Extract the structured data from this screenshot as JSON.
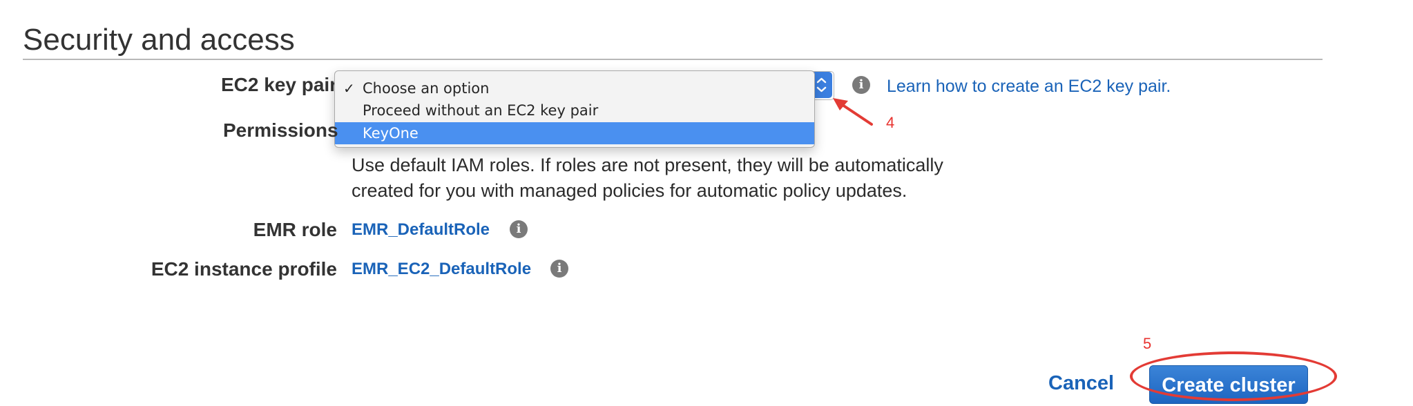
{
  "section": {
    "title": "Security and access"
  },
  "ec2_key_pair": {
    "label": "EC2 key pair",
    "options": [
      {
        "label": "Choose an option",
        "checked": true,
        "highlighted": false
      },
      {
        "label": "Proceed without an EC2 key pair",
        "checked": false,
        "highlighted": false
      },
      {
        "label": "KeyOne",
        "checked": false,
        "highlighted": true
      }
    ],
    "check_mark": "✓",
    "info_icon": "info-icon",
    "learn_link": "Learn how to create an EC2 key pair."
  },
  "permissions": {
    "label": "Permissions",
    "description_line1": "Use default IAM roles. If roles are not present, they will be automatically",
    "description_line2": "created for you with managed policies for automatic policy updates."
  },
  "emr_role": {
    "label": "EMR role",
    "value": "EMR_DefaultRole",
    "info_icon": "info-icon"
  },
  "ec2_instance_profile": {
    "label": "EC2 instance profile",
    "value": "EMR_EC2_DefaultRole",
    "info_icon": "info-icon"
  },
  "annotations": {
    "step4": "4",
    "step5": "5",
    "color": "#e33b35"
  },
  "actions": {
    "cancel_label": "Cancel",
    "create_label": "Create cluster"
  },
  "colors": {
    "link": "#1a63b8",
    "highlight": "#4a90f0",
    "primary_button": "#2670c8"
  }
}
